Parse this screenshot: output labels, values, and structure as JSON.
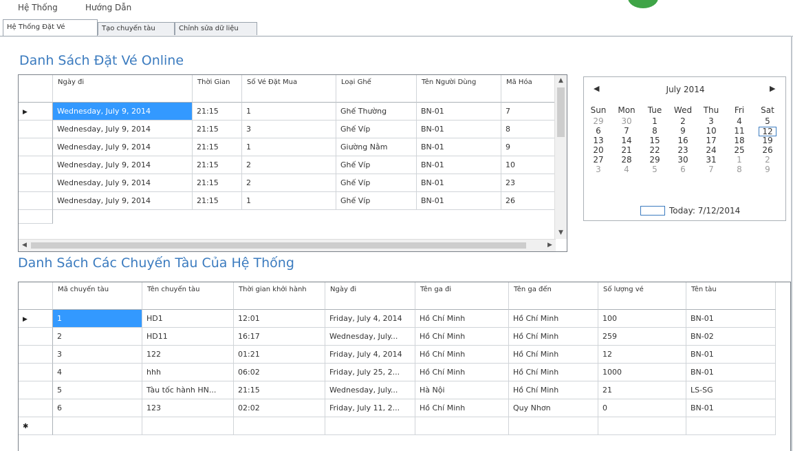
{
  "menu": [
    "Hệ Thống",
    "Hướng Dẫn"
  ],
  "tabs": [
    "Hệ Thống Đặt Vé",
    "Tạo chuyến tàu",
    "Chỉnh sửa dữ liệu"
  ],
  "bookings": {
    "title": "Danh Sách Đặt Vé Online",
    "columns": [
      "Ngày đi",
      "Thời Gian",
      "Số Vé Đặt Mua",
      "Loại Ghế",
      "Tên Người Dùng",
      "Mã Hóa"
    ],
    "rows": [
      [
        "Wednesday, July 9, 2014",
        "21:15",
        "1",
        "Ghế Thường",
        "BN-01",
        "7"
      ],
      [
        "Wednesday, July 9, 2014",
        "21:15",
        "3",
        "Ghế Víp",
        "BN-01",
        "8"
      ],
      [
        "Wednesday, July 9, 2014",
        "21:15",
        "1",
        "Giường Nằm",
        "BN-01",
        "9"
      ],
      [
        "Wednesday, July 9, 2014",
        "21:15",
        "2",
        "Ghế Víp",
        "BN-01",
        "10"
      ],
      [
        "Wednesday, July 9, 2014",
        "21:15",
        "2",
        "Ghế Víp",
        "BN-01",
        "23"
      ],
      [
        "Wednesday, July 9, 2014",
        "21:15",
        "1",
        "Ghế Víp",
        "BN-01",
        "26"
      ]
    ]
  },
  "calendar": {
    "month_label": "July 2014",
    "days_of_week": [
      "Sun",
      "Mon",
      "Tue",
      "Wed",
      "Thu",
      "Fri",
      "Sat"
    ],
    "weeks": [
      [
        "29",
        "30",
        "1",
        "2",
        "3",
        "4",
        "5"
      ],
      [
        "6",
        "7",
        "8",
        "9",
        "10",
        "11",
        "12"
      ],
      [
        "13",
        "14",
        "15",
        "16",
        "17",
        "18",
        "19"
      ],
      [
        "20",
        "21",
        "22",
        "23",
        "24",
        "25",
        "26"
      ],
      [
        "27",
        "28",
        "29",
        "30",
        "31",
        "1",
        "2"
      ],
      [
        "3",
        "4",
        "5",
        "6",
        "7",
        "8",
        "9"
      ]
    ],
    "today_label": "Today: 7/12/2014"
  },
  "trains": {
    "title": "Danh Sách Các Chuyến Tàu Của Hệ Thống",
    "columns": [
      "Mã chuyến tàu",
      "Tên chuyến tàu",
      "Thời gian khởi hành",
      "Ngày đi",
      "Tên ga đi",
      "Tên ga đến",
      "Số lượng vé",
      "Tên tàu"
    ],
    "rows": [
      [
        "1",
        "HD1",
        "12:01",
        "Friday, July 4, 2014",
        "Hồ Chí Minh",
        "Hồ Chí Minh",
        "100",
        "BN-01"
      ],
      [
        "2",
        "HD11",
        "16:17",
        "Wednesday, July...",
        "Hồ Chí Minh",
        "Hồ Chí Minh",
        "259",
        "BN-02"
      ],
      [
        "3",
        "122",
        "01:21",
        "Friday, July 4, 2014",
        "Hồ Chí Minh",
        "Hồ Chí Minh",
        "12",
        "BN-01"
      ],
      [
        "4",
        "hhh",
        "06:02",
        "Friday, July 25, 2...",
        "Hồ Chí Minh",
        "Hồ Chí Minh",
        "1000",
        "BN-01"
      ],
      [
        "5",
        "Tàu tốc hành HN...",
        "21:15",
        "Wednesday, July...",
        "Hà Nội",
        "Hồ Chí Minh",
        "21",
        "LS-SG"
      ],
      [
        "6",
        "123",
        "02:02",
        "Friday, July 11, 2...",
        "Hồ Chí Minh",
        "Quy Nhơn",
        "0",
        "BN-01"
      ]
    ]
  },
  "icons": {
    "row_pointer": "row-pointer-icon",
    "new_row": "new-row-icon"
  }
}
